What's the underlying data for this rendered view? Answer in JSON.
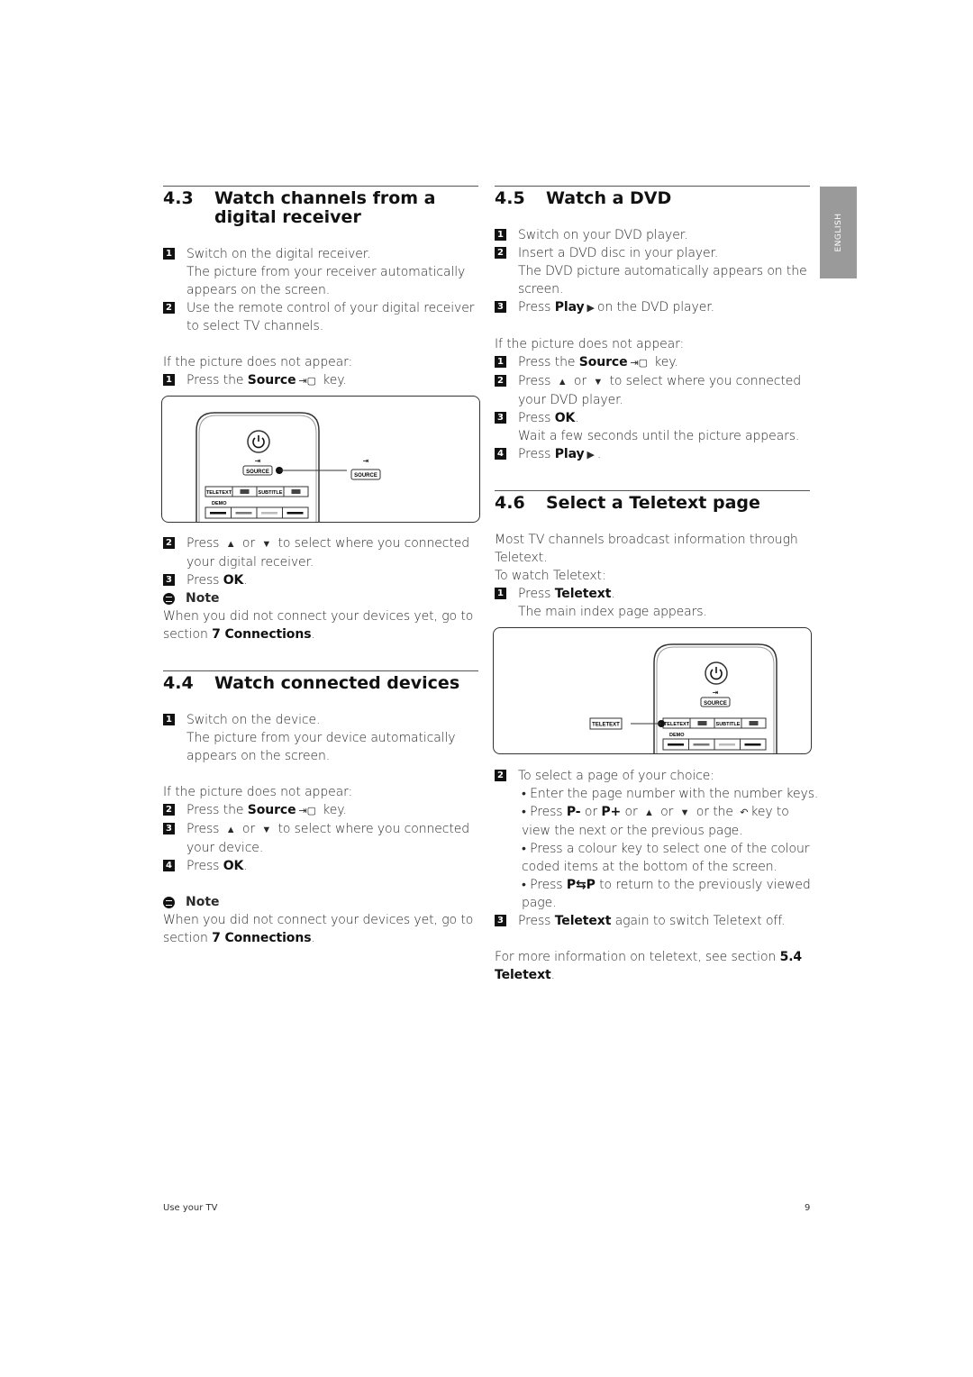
{
  "side_tab": "ENGLISH",
  "footer": {
    "left": "Use your TV",
    "page": "9"
  },
  "sections": {
    "s43": {
      "number": "4.3",
      "title_lines": [
        "Watch channels from a",
        "digital receiver"
      ],
      "blocks": [
        {
          "type": "step",
          "num": "1",
          "lines": [
            [
              {
                "t": "Switch on the digital receiver."
              }
            ],
            [
              {
                "t": "The picture from your receiver automatically"
              }
            ],
            [
              {
                "t": "appears on the screen."
              }
            ]
          ]
        },
        {
          "type": "step",
          "num": "2",
          "lines": [
            [
              {
                "t": "Use the remote control of your digital receiver"
              }
            ],
            [
              {
                "t": "to select TV channels."
              }
            ]
          ]
        },
        {
          "type": "gap"
        },
        {
          "type": "para",
          "lines": [
            [
              {
                "t": "If the picture does not appear:"
              }
            ]
          ]
        },
        {
          "type": "step",
          "num": "1",
          "lines": [
            [
              {
                "t": "Press the "
              },
              {
                "b": "Source"
              },
              {
                "icon": "source-icon"
              },
              {
                "t": " key."
              }
            ]
          ]
        },
        {
          "type": "fig",
          "fig": "fig1"
        },
        {
          "type": "step",
          "num": "2",
          "lines": [
            [
              {
                "t": "Press "
              },
              {
                "icon": "up-arrow-icon"
              },
              {
                "t": " or "
              },
              {
                "icon": "down-arrow-icon"
              },
              {
                "t": " to select where you connected"
              }
            ],
            [
              {
                "t": "your digital receiver."
              }
            ]
          ]
        },
        {
          "type": "step",
          "num": "3",
          "lines": [
            [
              {
                "t": "Press "
              },
              {
                "b": "OK"
              },
              {
                "t": "."
              }
            ]
          ]
        },
        {
          "type": "note",
          "label": "Note"
        },
        {
          "type": "para",
          "lines": [
            [
              {
                "t": "When you did not connect your devices yet, go to"
              }
            ],
            [
              {
                "t": "section "
              },
              {
                "b": "7 Connections"
              },
              {
                "t": "."
              }
            ]
          ]
        }
      ]
    },
    "s44": {
      "number": "4.4",
      "title_lines": [
        "Watch connected devices"
      ],
      "blocks": [
        {
          "type": "step",
          "num": "1",
          "lines": [
            [
              {
                "t": "Switch on the device."
              }
            ],
            [
              {
                "t": "The picture from your device automatically"
              }
            ],
            [
              {
                "t": "appears on the screen."
              }
            ]
          ]
        },
        {
          "type": "gap"
        },
        {
          "type": "para",
          "lines": [
            [
              {
                "t": "If the picture does not appear:"
              }
            ]
          ]
        },
        {
          "type": "step",
          "num": "2",
          "lines": [
            [
              {
                "t": "Press the "
              },
              {
                "b": "Source"
              },
              {
                "icon": "source-icon"
              },
              {
                "t": " key."
              }
            ]
          ]
        },
        {
          "type": "step",
          "num": "3",
          "lines": [
            [
              {
                "t": "Press "
              },
              {
                "icon": "up-arrow-icon"
              },
              {
                "t": " or "
              },
              {
                "icon": "down-arrow-icon"
              },
              {
                "t": " to select where you connected"
              }
            ],
            [
              {
                "t": "your device."
              }
            ]
          ]
        },
        {
          "type": "step",
          "num": "4",
          "lines": [
            [
              {
                "t": "Press "
              },
              {
                "b": "OK"
              },
              {
                "t": "."
              }
            ]
          ]
        },
        {
          "type": "gap"
        },
        {
          "type": "note",
          "label": "Note"
        },
        {
          "type": "para",
          "lines": [
            [
              {
                "t": "When you did not connect your devices yet, go to"
              }
            ],
            [
              {
                "t": "section "
              },
              {
                "b": "7 Connections"
              },
              {
                "t": "."
              }
            ]
          ]
        }
      ]
    },
    "s45": {
      "number": "4.5",
      "title_lines": [
        "Watch a DVD"
      ],
      "blocks": [
        {
          "type": "step",
          "num": "1",
          "lines": [
            [
              {
                "t": "Switch on your DVD player."
              }
            ]
          ]
        },
        {
          "type": "step",
          "num": "2",
          "lines": [
            [
              {
                "t": "Insert a DVD disc in your player."
              }
            ],
            [
              {
                "t": "The DVD picture automatically appears on the"
              }
            ],
            [
              {
                "t": "screen."
              }
            ]
          ]
        },
        {
          "type": "step",
          "num": "3",
          "lines": [
            [
              {
                "t": "Press "
              },
              {
                "b": "Play"
              },
              {
                "icon": "play-icon"
              },
              {
                "t": "on the DVD player."
              }
            ]
          ]
        },
        {
          "type": "gap"
        },
        {
          "type": "para",
          "lines": [
            [
              {
                "t": "If the picture does not appear:"
              }
            ]
          ]
        },
        {
          "type": "step",
          "num": "1",
          "lines": [
            [
              {
                "t": "Press the "
              },
              {
                "b": "Source"
              },
              {
                "icon": "source-icon"
              },
              {
                "t": " key."
              }
            ]
          ]
        },
        {
          "type": "step",
          "num": "2",
          "lines": [
            [
              {
                "t": "Press "
              },
              {
                "icon": "up-arrow-icon"
              },
              {
                "t": " or "
              },
              {
                "icon": "down-arrow-icon"
              },
              {
                "t": " to select where you connected"
              }
            ],
            [
              {
                "t": "your DVD player."
              }
            ]
          ]
        },
        {
          "type": "step",
          "num": "3",
          "lines": [
            [
              {
                "t": "Press "
              },
              {
                "b": "OK"
              },
              {
                "t": "."
              }
            ],
            [
              {
                "t": "Wait a few seconds until the picture appears."
              }
            ]
          ]
        },
        {
          "type": "step",
          "num": "4",
          "lines": [
            [
              {
                "t": "Press "
              },
              {
                "b": "Play"
              },
              {
                "icon": "play-icon"
              },
              {
                "t": "."
              }
            ]
          ]
        }
      ]
    },
    "s46": {
      "number": "4.6",
      "title_lines": [
        "Select a Teletext page"
      ],
      "blocks": [
        {
          "type": "para",
          "lines": [
            [
              {
                "t": "Most TV channels broadcast information through"
              }
            ],
            [
              {
                "t": "Teletext."
              }
            ],
            [
              {
                "t": "To watch Teletext:"
              }
            ]
          ]
        },
        {
          "type": "step",
          "num": "1",
          "lines": [
            [
              {
                "t": "Press "
              },
              {
                "b": "Teletext"
              },
              {
                "t": "."
              }
            ],
            [
              {
                "t": "The main index page appears."
              }
            ]
          ]
        },
        {
          "type": "fig",
          "fig": "fig2"
        },
        {
          "type": "step",
          "num": "2",
          "lines": [
            [
              {
                "t": "To select a page of your choice:"
              }
            ]
          ]
        },
        {
          "type": "bullets",
          "lines": [
            [
              {
                "t": "• Enter the page number with the number keys."
              }
            ],
            [
              {
                "t": "• Press "
              },
              {
                "b": "P-"
              },
              {
                "t": " or "
              },
              {
                "b": "P+"
              },
              {
                "t": " or "
              },
              {
                "icon": "up-arrow-icon"
              },
              {
                "t": " or "
              },
              {
                "icon": "down-arrow-icon"
              },
              {
                "t": " or the "
              },
              {
                "icon": "back-icon"
              },
              {
                "t": "key  to"
              }
            ],
            [
              {
                "t": " view the next or the previous page."
              }
            ],
            [
              {
                "t": "• Press a colour key to select one of the colour"
              }
            ],
            [
              {
                "t": " coded items at the bottom of the screen."
              }
            ],
            [
              {
                "t": "• Press "
              },
              {
                "b": "P⇆P"
              },
              {
                "t": " to return to the previously viewed"
              }
            ],
            [
              {
                "t": " page."
              }
            ]
          ]
        },
        {
          "type": "step",
          "num": "3",
          "lines": [
            [
              {
                "t": "Press "
              },
              {
                "b": "Teletext"
              },
              {
                "t": " again to switch Teletext off."
              }
            ]
          ]
        },
        {
          "type": "gap"
        },
        {
          "type": "para",
          "lines": [
            [
              {
                "t": "For more information on teletext, see section "
              },
              {
                "b": "5.4"
              }
            ],
            [
              {
                "b": "Teletext"
              },
              {
                "t": "."
              }
            ]
          ]
        }
      ]
    }
  },
  "figures": {
    "fig1": {
      "keys": [
        "TELETEXT",
        "SUBTITLE"
      ],
      "source": "SOURCE",
      "demo": "DEMO",
      "callout": "SOURCE"
    },
    "fig2": {
      "keys": [
        "TELETEXT",
        "SUBTITLE"
      ],
      "source": "SOURCE",
      "demo": "DEMO",
      "callout": "TELETEXT"
    }
  }
}
